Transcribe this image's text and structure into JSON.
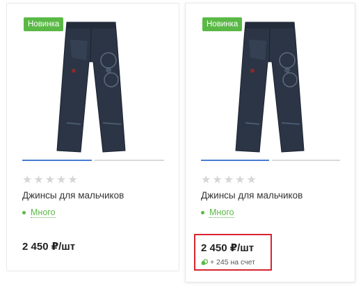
{
  "colors": {
    "accent": "#5ab946",
    "highlight": "#d7232e",
    "pager_active": "#4a7bd4"
  },
  "products": [
    {
      "badge": "Новинка",
      "image": "jeans-photo",
      "rating_stars": 0,
      "rating_max": 5,
      "title": "Джинсы для мальчиков",
      "stock": "Много",
      "price": "2 450 ₽/шт"
    },
    {
      "badge": "Новинка",
      "image": "jeans-photo",
      "rating_stars": 0,
      "rating_max": 5,
      "title": "Джинсы для мальчиков",
      "stock": "Много",
      "price": "2 450 ₽/шт",
      "bonus": "+ 245 на счет"
    }
  ]
}
